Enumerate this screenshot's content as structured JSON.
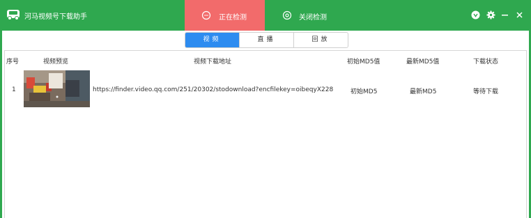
{
  "app": {
    "title": "河马视频号下载助手"
  },
  "top_tabs": {
    "detecting_label": "正在检测",
    "close_label": "关闭检测"
  },
  "window_controls": {
    "icons": [
      "shield-icon",
      "gear-icon",
      "minimize-icon",
      "close-icon"
    ]
  },
  "segments": {
    "items": [
      "视频",
      "直播",
      "回放"
    ],
    "active_index": 0
  },
  "table": {
    "headers": {
      "index": "序号",
      "preview": "视频预览",
      "url": "视频下载地址",
      "initial_md5": "初始MD5值",
      "latest_md5": "最新MD5值",
      "status": "下载状态"
    },
    "rows": [
      {
        "index": "1",
        "url": "https://finder.video.qq.com/251/20302/stodownload?encfilekey=oibeqyX228",
        "initial_md5": "初始MD5",
        "latest_md5": "最新MD5",
        "status": "等待下载"
      }
    ]
  },
  "colors": {
    "brand_green": "#2fa84f",
    "active_tab_red": "#f26b6b",
    "segment_blue": "#2d8cf0"
  }
}
